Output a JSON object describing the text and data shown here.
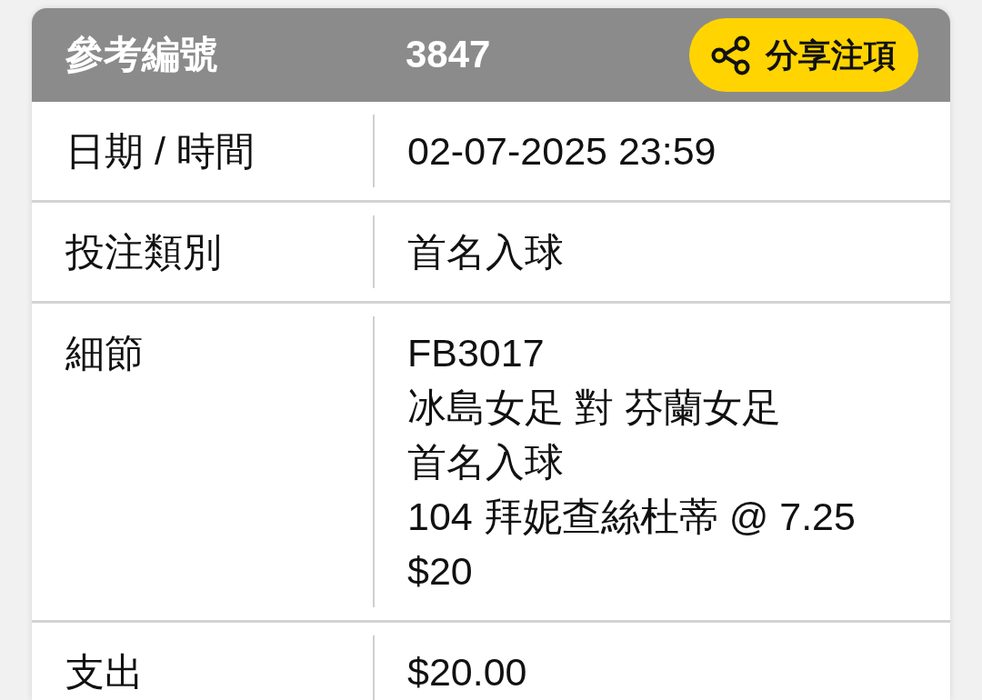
{
  "header": {
    "label": "參考編號",
    "value": "3847",
    "share_button": {
      "label": "分享注項"
    }
  },
  "rows": [
    {
      "label": "日期 / 時間",
      "lines": [
        "02-07-2025 23:59"
      ]
    },
    {
      "label": "投注類別",
      "lines": [
        "首名入球"
      ]
    },
    {
      "label": "細節",
      "lines": [
        "FB3017",
        "冰島女足 對 芬蘭女足",
        "首名入球",
        "104 拜妮查絲杜蒂 @ 7.25",
        "$20"
      ]
    },
    {
      "label": "支出",
      "lines": [
        "$20.00"
      ]
    }
  ]
}
